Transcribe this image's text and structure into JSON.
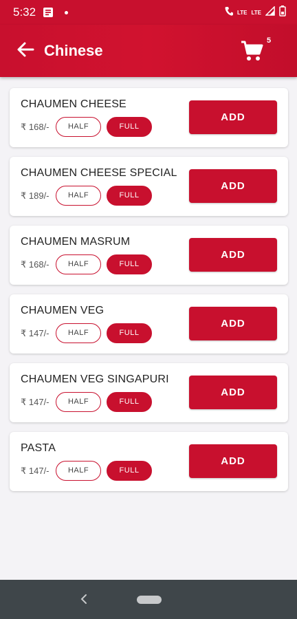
{
  "status_bar": {
    "time": "5:32",
    "network_label": "LTE",
    "network_label_2": "LTE"
  },
  "header": {
    "title": "Chinese",
    "cart_count": "5"
  },
  "items": [
    {
      "name": "CHAUMEN CHEESE",
      "price": "₹ 168/-",
      "half_label": "HALF",
      "full_label": "FULL",
      "add_label": "ADD"
    },
    {
      "name": "CHAUMEN CHEESE SPECIAL",
      "price": "₹ 189/-",
      "half_label": "HALF",
      "full_label": "FULL",
      "add_label": "ADD"
    },
    {
      "name": "CHAUMEN MASRUM",
      "price": "₹ 168/-",
      "half_label": "HALF",
      "full_label": "FULL",
      "add_label": "ADD"
    },
    {
      "name": "CHAUMEN VEG",
      "price": "₹ 147/-",
      "half_label": "HALF",
      "full_label": "FULL",
      "add_label": "ADD"
    },
    {
      "name": "CHAUMEN VEG SINGAPURI",
      "price": "₹ 147/-",
      "half_label": "HALF",
      "full_label": "FULL",
      "add_label": "ADD"
    },
    {
      "name": "PASTA",
      "price": "₹ 147/-",
      "half_label": "HALF",
      "full_label": "FULL",
      "add_label": "ADD"
    }
  ],
  "colors": {
    "accent": "#c8102e",
    "background": "#f4f3f6",
    "nav_bar": "#3f464a"
  },
  "icons": {
    "back": "arrow-left-icon",
    "cart": "shopping-cart-icon",
    "nav_back": "chevron-left-icon",
    "nav_home": "home-pill-icon"
  }
}
